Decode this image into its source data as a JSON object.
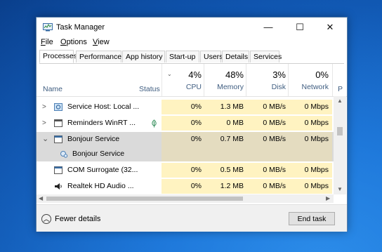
{
  "window": {
    "title": "Task Manager",
    "minimize": "—",
    "maximize": "☐",
    "close": "✕"
  },
  "menu": [
    {
      "label": "File",
      "u": "F",
      "rest": "ile"
    },
    {
      "label": "Options",
      "u": "O",
      "rest": "ptions"
    },
    {
      "label": "View",
      "u": "V",
      "rest": "iew"
    }
  ],
  "tabs": [
    "Processes",
    "Performance",
    "App history",
    "Start-up",
    "Users",
    "Details",
    "Services"
  ],
  "header": {
    "name": "Name",
    "status": "Status",
    "cpu": {
      "pct": "4%",
      "label": "CPU"
    },
    "memory": {
      "pct": "48%",
      "label": "Memory"
    },
    "disk": {
      "pct": "3%",
      "label": "Disk"
    },
    "network": {
      "pct": "0%",
      "label": "Network"
    },
    "more": "P"
  },
  "rows": [
    {
      "name": "Service Host: Local ...",
      "status": "",
      "cpu": "0%",
      "memory": "1.3 MB",
      "disk": "0 MB/s",
      "network": "0 Mbps",
      "caret": ">",
      "icon": "gear-icon"
    },
    {
      "name": "Reminders WinRT ...",
      "status": "leaf",
      "cpu": "0%",
      "memory": "0 MB",
      "disk": "0 MB/s",
      "network": "0 Mbps",
      "caret": ">",
      "icon": "app-window-icon"
    },
    {
      "name": "Bonjour Service",
      "status": "",
      "cpu": "0%",
      "memory": "0.7 MB",
      "disk": "0 MB/s",
      "network": "0 Mbps",
      "caret": "v",
      "icon": "app-window-icon"
    },
    {
      "name": "Bonjour Service",
      "status": "",
      "cpu": "",
      "memory": "",
      "disk": "",
      "network": "",
      "caret": "",
      "icon": "service-gear-icon"
    },
    {
      "name": "COM Surrogate (32...",
      "status": "",
      "cpu": "0%",
      "memory": "0.5 MB",
      "disk": "0 MB/s",
      "network": "0 Mbps",
      "caret": "",
      "icon": "app-window-icon"
    },
    {
      "name": "Realtek HD Audio ...",
      "status": "",
      "cpu": "0%",
      "memory": "1.2 MB",
      "disk": "0 MB/s",
      "network": "0 Mbps",
      "caret": "",
      "icon": "speaker-icon"
    }
  ],
  "footer": {
    "fewer": "Fewer details",
    "fewer_u": "d",
    "end_task": "End task",
    "end_u": "E"
  }
}
